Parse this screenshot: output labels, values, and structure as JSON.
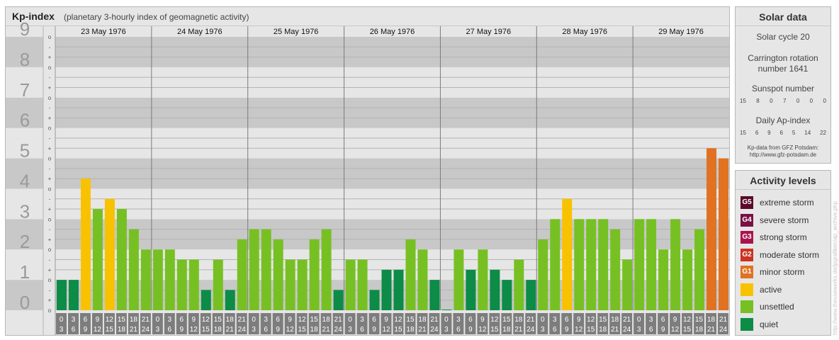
{
  "header": {
    "title": "Kp-index",
    "subtitle": "(planetary 3-hourly index of geomagnetic activity)"
  },
  "chart_data": {
    "type": "bar",
    "ylim": [
      0,
      9
    ],
    "y_tick_labels": [
      "0",
      "1",
      "2",
      "3",
      "4",
      "5",
      "6",
      "7",
      "8",
      "9"
    ],
    "sub_tick_labels": [
      "+",
      "o",
      "-"
    ],
    "days": [
      "23 May 1976",
      "24 May 1976",
      "25 May 1976",
      "26 May 1976",
      "27 May 1976",
      "28 May 1976",
      "29 May 1976"
    ],
    "interval_labels": [
      [
        "0",
        "3"
      ],
      [
        "3",
        "6"
      ],
      [
        "6",
        "9"
      ],
      [
        "9",
        "12"
      ],
      [
        "12",
        "15"
      ],
      [
        "15",
        "18"
      ],
      [
        "18",
        "21"
      ],
      [
        "21",
        "24"
      ]
    ],
    "values": [
      1.0,
      1.0,
      4.333,
      3.333,
      3.667,
      3.333,
      2.667,
      2.0,
      2.0,
      2.0,
      1.667,
      1.667,
      0.667,
      1.667,
      0.667,
      2.333,
      2.667,
      2.667,
      2.333,
      1.667,
      1.667,
      2.333,
      2.667,
      0.667,
      1.667,
      1.667,
      0.667,
      1.333,
      1.333,
      2.333,
      2.0,
      1.0,
      0.0,
      2.0,
      1.333,
      2.0,
      1.333,
      1.0,
      1.667,
      1.0,
      2.333,
      3.0,
      3.667,
      3.0,
      3.0,
      3.0,
      2.667,
      1.667,
      3.0,
      3.0,
      2.0,
      3.0,
      2.0,
      2.667,
      5.333,
      5.0
    ],
    "colors": {
      "quiet": "#0c8c46",
      "unsettled": "#77c023",
      "active": "#f8c200",
      "minor_storm": "#e07222"
    }
  },
  "solar": {
    "title": "Solar data",
    "cycle_label": "Solar cycle 20",
    "carrington_line1": "Carrington rotation",
    "carrington_line2": "number 1641",
    "sunspot_label": "Sunspot number",
    "sunspot_values": [
      "15",
      "8",
      "0",
      "7",
      "0",
      "0",
      "0"
    ],
    "ap_label": "Daily Ap-index",
    "ap_values": [
      "15",
      "6",
      "9",
      "6",
      "5",
      "14",
      "22"
    ],
    "source_line1": "Kp-data from GFZ Potsdam:",
    "source_line2": "http://www.gfz-potsdam.de"
  },
  "activity": {
    "title": "Activity levels",
    "levels": [
      {
        "code": "G5",
        "label": "extreme storm",
        "color": "#5a0a2a"
      },
      {
        "code": "G4",
        "label": "severe storm",
        "color": "#7a0f44"
      },
      {
        "code": "G3",
        "label": "strong storm",
        "color": "#a8154d"
      },
      {
        "code": "G2",
        "label": "moderate storm",
        "color": "#cc3322"
      },
      {
        "code": "G1",
        "label": "minor storm",
        "color": "#e07222"
      },
      {
        "code": "",
        "label": "active",
        "color": "#f8c200"
      },
      {
        "code": "",
        "label": "unsettled",
        "color": "#77c023"
      },
      {
        "code": "",
        "label": "quiet",
        "color": "#0c8c46"
      }
    ]
  },
  "watermark": "http://www.theusewerks.de/jpgrafiken/ap_archive.php"
}
